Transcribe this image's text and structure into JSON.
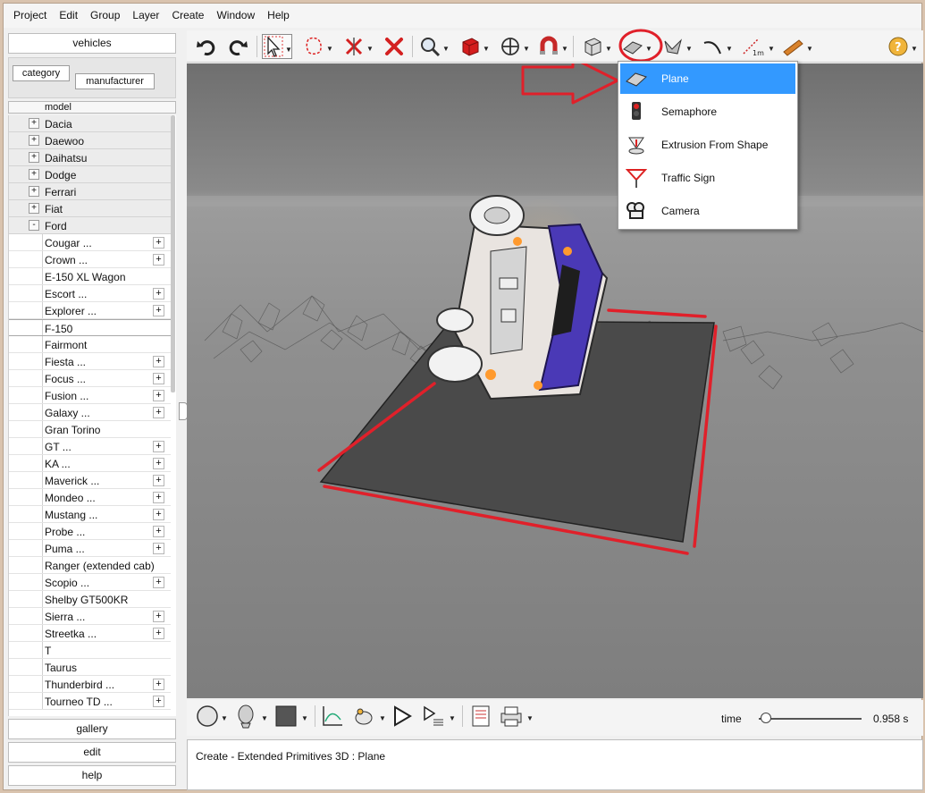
{
  "menubar": {
    "items": [
      "Project",
      "Edit",
      "Group",
      "Layer",
      "Create",
      "Window",
      "Help"
    ]
  },
  "left_panel": {
    "top_button": "vehicles",
    "tabs": [
      "category",
      "manufacturer"
    ],
    "column_header": "model",
    "manufacturers": [
      {
        "toggle": "+",
        "name": "Dacia"
      },
      {
        "toggle": "+",
        "name": "Daewoo"
      },
      {
        "toggle": "+",
        "name": "Daihatsu"
      },
      {
        "toggle": "+",
        "name": "Dodge"
      },
      {
        "toggle": "+",
        "name": "Ferrari"
      },
      {
        "toggle": "+",
        "name": "Fiat"
      },
      {
        "toggle": "-",
        "name": "Ford"
      }
    ],
    "models": [
      {
        "name": "Cougar ...",
        "expandable": true
      },
      {
        "name": "Crown ...",
        "expandable": true
      },
      {
        "name": "E-150 XL Wagon",
        "expandable": false
      },
      {
        "name": "Escort ...",
        "expandable": true
      },
      {
        "name": "Explorer ...",
        "expandable": true
      },
      {
        "name": "F-150",
        "expandable": false,
        "selected": true
      },
      {
        "name": "Fairmont",
        "expandable": false
      },
      {
        "name": "Fiesta ...",
        "expandable": true
      },
      {
        "name": "Focus ...",
        "expandable": true
      },
      {
        "name": "Fusion ...",
        "expandable": true
      },
      {
        "name": "Galaxy ...",
        "expandable": true
      },
      {
        "name": "Gran Torino",
        "expandable": false
      },
      {
        "name": "GT ...",
        "expandable": true
      },
      {
        "name": "KA ...",
        "expandable": true
      },
      {
        "name": "Maverick ...",
        "expandable": true
      },
      {
        "name": "Mondeo ...",
        "expandable": true
      },
      {
        "name": "Mustang ...",
        "expandable": true
      },
      {
        "name": "Probe ...",
        "expandable": true
      },
      {
        "name": "Puma ...",
        "expandable": true
      },
      {
        "name": "Ranger (extended cab)",
        "expandable": false
      },
      {
        "name": "Scopio ...",
        "expandable": true
      },
      {
        "name": "Shelby GT500KR",
        "expandable": false
      },
      {
        "name": "Sierra ...",
        "expandable": true
      },
      {
        "name": "Streetka ...",
        "expandable": true
      },
      {
        "name": "T",
        "expandable": false
      },
      {
        "name": "Taurus",
        "expandable": false
      },
      {
        "name": "Thunderbird ...",
        "expandable": true
      },
      {
        "name": "Tourneo TD ...",
        "expandable": true
      }
    ],
    "bottom_buttons": [
      "gallery",
      "edit",
      "help"
    ]
  },
  "toolbar": {
    "icons": [
      "undo-icon",
      "redo-icon",
      "select-arrow-icon",
      "lasso-icon",
      "remove-icon",
      "delete-x-icon",
      "zoom-icon",
      "box-red-icon",
      "move-icon",
      "magnet-icon",
      "cube-icon",
      "plane-icon",
      "wedge-icon",
      "curve-icon",
      "measure-icon",
      "ruler-icon",
      "help-icon"
    ],
    "highlight_color": "#e0202a"
  },
  "dropdown": {
    "items": [
      {
        "label": "Plane",
        "icon": "plane-icon",
        "active": true
      },
      {
        "label": "Semaphore",
        "icon": "semaphore-icon",
        "active": false
      },
      {
        "label": "Extrusion From Shape",
        "icon": "extrusion-icon",
        "active": false
      },
      {
        "label": "Traffic Sign",
        "icon": "traffic-sign-icon",
        "active": false
      },
      {
        "label": "Camera",
        "icon": "camera-icon",
        "active": false
      }
    ],
    "active_color": "#3399ff"
  },
  "bottom_toolbar": {
    "time_label": "time",
    "time_value": "0.958 s",
    "slider_fraction": 0.03
  },
  "status": {
    "text": "Create - Extended Primitives 3D : Plane"
  }
}
